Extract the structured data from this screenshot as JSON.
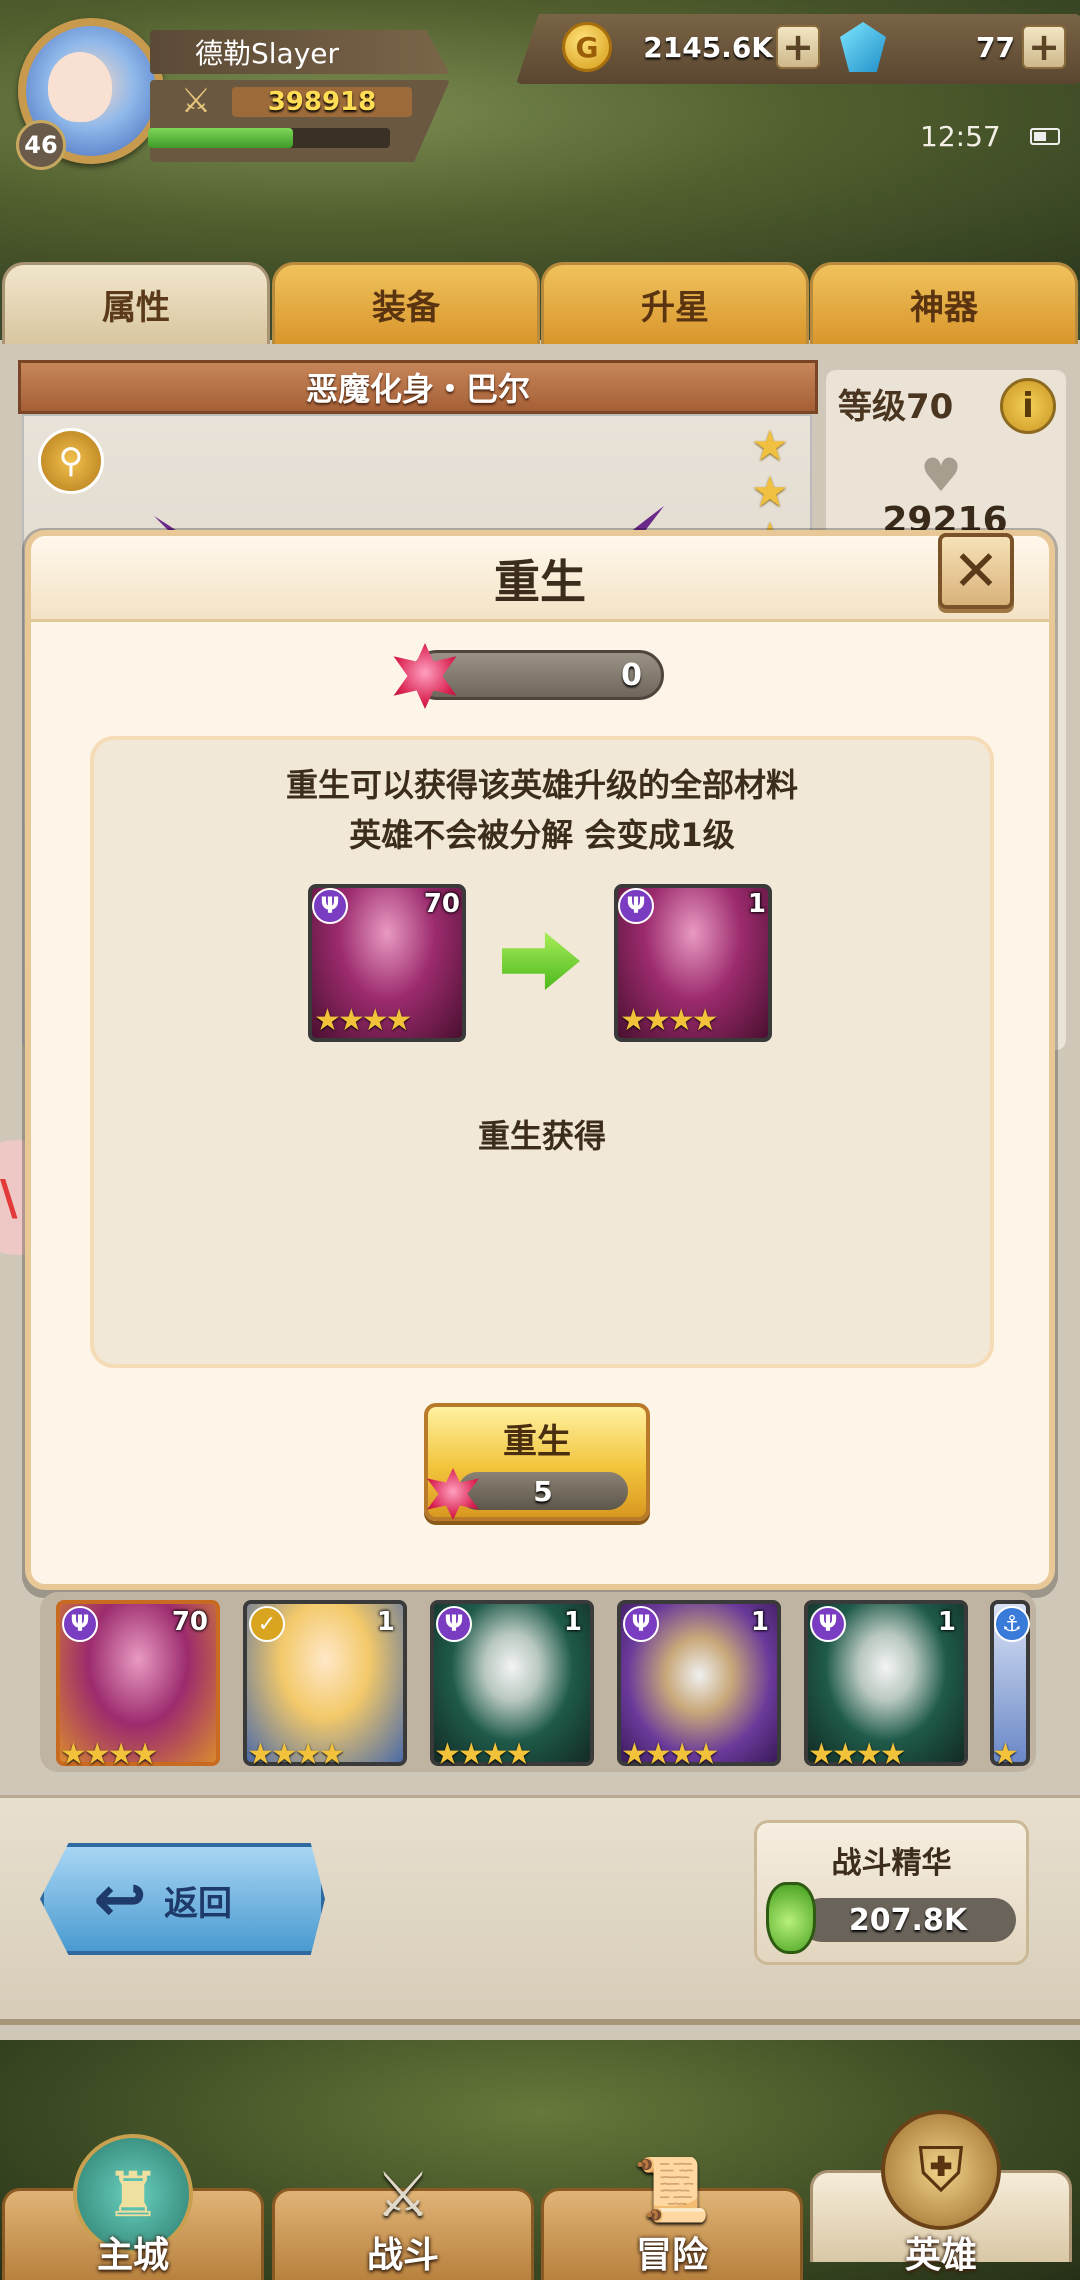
{
  "player": {
    "name": "德勒Slayer",
    "level": "46",
    "power": "398918",
    "exp_fraction": 0.6
  },
  "resources": {
    "gold_symbol": "G",
    "gold": "2145.6K",
    "gems": "77",
    "plus": "+"
  },
  "status_bar": {
    "time": "12:57"
  },
  "tabs": [
    {
      "label": "属性",
      "active": true
    },
    {
      "label": "装备",
      "active": false
    },
    {
      "label": "升星",
      "active": false
    },
    {
      "label": "神器",
      "active": false
    }
  ],
  "hero": {
    "name": "恶魔化身・巴尔",
    "level_label": "等级70",
    "info": "i",
    "hp": "29216"
  },
  "modal": {
    "title": "重生",
    "close": "✕",
    "crystal_count": "0",
    "description_line1": "重生可以获得该英雄升级的全部材料",
    "description_line2": "英雄不会被分解 会变成1级",
    "before_level": "70",
    "after_level": "1",
    "gain_label": "重生获得",
    "button_label": "重生",
    "button_cost": "5"
  },
  "roster": [
    {
      "level": "70",
      "stars": 4,
      "faction": "dark",
      "selected": true
    },
    {
      "level": "1",
      "stars": 4,
      "faction": "light",
      "selected": false
    },
    {
      "level": "1",
      "stars": 4,
      "faction": "dark",
      "selected": false
    },
    {
      "level": "1",
      "stars": 4,
      "faction": "dark",
      "selected": false
    },
    {
      "level": "1",
      "stars": 4,
      "faction": "dark",
      "selected": false
    },
    {
      "level": "",
      "stars": 1,
      "faction": "water",
      "selected": false
    }
  ],
  "back_button": {
    "label": "返回"
  },
  "essence": {
    "title": "战斗精华",
    "value": "207.8K"
  },
  "nav": [
    {
      "label": "主城",
      "icon": "castle-icon",
      "active": false
    },
    {
      "label": "战斗",
      "icon": "crossed-swords-icon",
      "active": false
    },
    {
      "label": "冒险",
      "icon": "scroll-map-icon",
      "active": false
    },
    {
      "label": "英雄",
      "icon": "helmet-icon",
      "active": true
    }
  ],
  "colors": {
    "tab_gold": "#d9962c",
    "modal_bg": "#fdf5e8",
    "dark_faction": "#7a3cc0",
    "button_gold": "#f2c43c"
  }
}
